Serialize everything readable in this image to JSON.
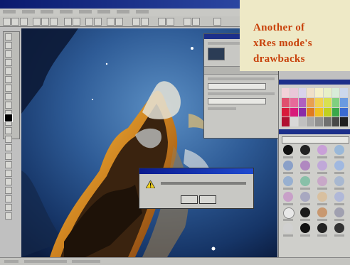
{
  "caption": {
    "line1": "Another of",
    "line2": "xRes mode's",
    "line3": "drawbacks"
  },
  "icons": {
    "warning": "warning-triangle-icon",
    "foreground_swatch": "color-swatch-icon"
  },
  "colors": {
    "caption_text": "#c8410a",
    "caption_bg": "#eee9c6",
    "titlebar": "#0a1a6e"
  }
}
